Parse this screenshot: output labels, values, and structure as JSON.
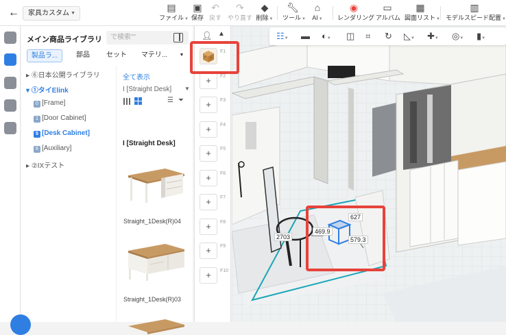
{
  "topbar": {
    "project_select": "家具カスタム",
    "tools": [
      {
        "label": "ファイル",
        "icon": "file-icon"
      },
      {
        "label": "保存",
        "icon": "save-icon"
      },
      {
        "label": "戻す",
        "icon": "undo-icon"
      },
      {
        "label": "やり直す",
        "icon": "redo-icon"
      },
      {
        "label": "削除",
        "icon": "eraser-icon"
      },
      {
        "label": "ツール",
        "icon": "wrench-icon"
      },
      {
        "label": "AI",
        "icon": "ai-house-icon"
      },
      {
        "label": "レンダリング",
        "icon": "camera-icon"
      },
      {
        "label": "アルバム",
        "icon": "album-icon"
      },
      {
        "label": "図面リスト",
        "icon": "drawing-list-icon"
      },
      {
        "label": "モデルスピード配置",
        "icon": "speed-layout-icon"
      }
    ]
  },
  "library": {
    "title": "メイン商品ライブラリ",
    "search_placeholder": "で検索\"\"",
    "tabs": [
      "製品ラ...",
      "部品",
      "セット",
      "マテリ..."
    ],
    "tree": [
      {
        "label": "⑥日本公開ライブラリ"
      },
      {
        "label": "①タイElink"
      },
      {
        "badge": "0",
        "label": "[Frame]"
      },
      {
        "badge": "1",
        "label": "[Door Cabinet]"
      },
      {
        "badge": "5",
        "label": "[Desk Cabinet]"
      },
      {
        "badge": "6",
        "label": "[Auxiliary]"
      },
      {
        "label": "②IXテスト"
      }
    ],
    "show_all": "全て表示",
    "subcategory": "I [Straight Desk]",
    "group_heading": "I [Straight Desk]",
    "products": [
      {
        "name": "Straight_1Desk(R)04"
      },
      {
        "name": "Straight_1Desk(R)03"
      }
    ]
  },
  "slots": {
    "keys": [
      "F1",
      "F2",
      "F3",
      "F4",
      "F5",
      "F6",
      "F7",
      "F8",
      "F9",
      "F10"
    ],
    "add_symbol": "+"
  },
  "viewport": {
    "dimensions": {
      "left": "2703",
      "width": "469.9",
      "depth": "627",
      "height": "579.3"
    }
  },
  "colors": {
    "accent": "#2f7fe3",
    "highlight": "#e6433b"
  }
}
